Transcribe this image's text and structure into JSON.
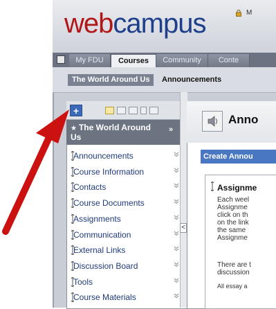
{
  "header": {
    "logo_web": "web",
    "logo_campus": "campus",
    "user_initial": "M"
  },
  "tabs": [
    {
      "label": "My FDU",
      "active": false
    },
    {
      "label": "Courses",
      "active": true
    },
    {
      "label": "Community",
      "active": false
    },
    {
      "label": "Conte",
      "active": false
    }
  ],
  "breadcrumb": {
    "course": "The World Around Us",
    "current": "Announcements"
  },
  "course_menu": {
    "add_label": "+",
    "title": "The World Around Us",
    "collapse_label": "»",
    "items": [
      {
        "label": "Announcements"
      },
      {
        "label": "Course Information"
      },
      {
        "label": "Contacts"
      },
      {
        "label": "Course Documents"
      },
      {
        "label": "Assignments"
      },
      {
        "label": "Communication"
      },
      {
        "label": "External Links"
      },
      {
        "label": "Discussion Board"
      },
      {
        "label": "Tools"
      },
      {
        "label": "Course Materials"
      }
    ]
  },
  "splitter": {
    "label": "<"
  },
  "content": {
    "title": "Anno",
    "create_button": "Create Annou",
    "announcement": {
      "title": "Assignme",
      "body_lines": [
        "Each weel",
        "Assignme",
        "click on th",
        "on the link",
        "the same",
        "Assignme"
      ],
      "para2_lines": [
        "There are t",
        "discussion"
      ],
      "para3_lines": [
        "All essay a"
      ]
    }
  },
  "colors": {
    "brand_red": "#b11717",
    "brand_blue": "#1e3f8a",
    "annotation_arrow": "#cc1111"
  }
}
